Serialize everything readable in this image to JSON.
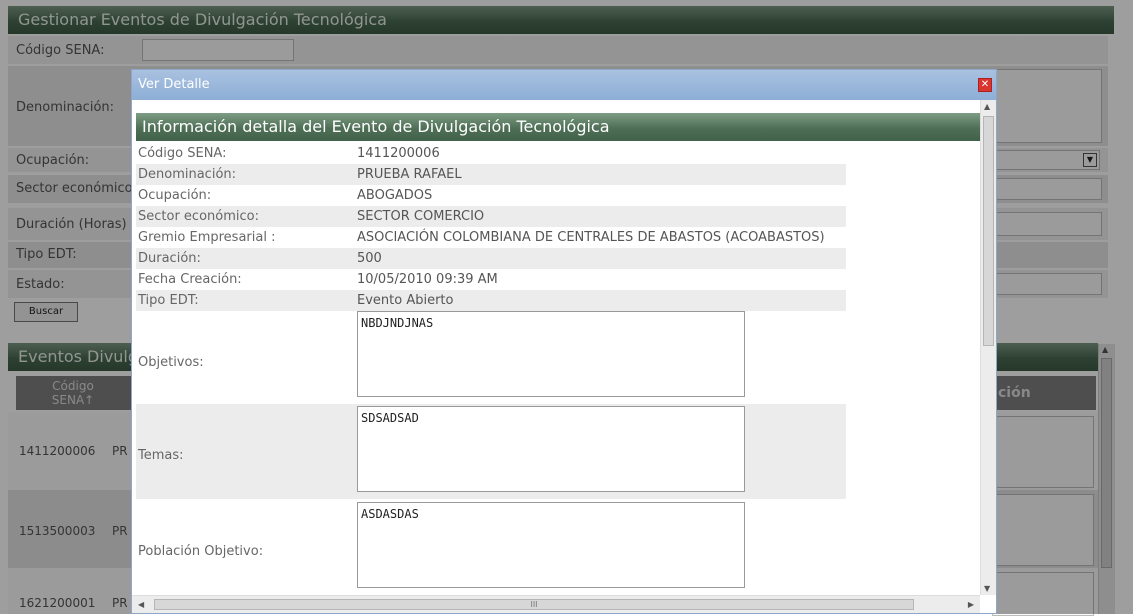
{
  "page": {
    "title": "Gestionar Eventos de Divulgación Tecnológica",
    "fields": {
      "codigo": "Código SENA:",
      "denominacion": "Denominación:",
      "ocupacion": "Ocupación:",
      "sector": "Sector económico",
      "duracion": "Duración (Horas)",
      "tipo": "Tipo EDT:",
      "estado": "Estado:"
    },
    "search_button": "Buscar",
    "results_title": "Eventos Divulg",
    "table": {
      "col_codigo": "Código SENA↑",
      "col_right": "ción"
    },
    "rows": [
      {
        "codigo": "1411200006",
        "denom": "PR"
      },
      {
        "codigo": "1513500003",
        "denom": "PR"
      },
      {
        "codigo": "1621200001",
        "denom": "PR"
      }
    ]
  },
  "modal": {
    "title": "Ver Detalle",
    "close": "✕",
    "header": "Información detalla del Evento de Divulgación Tecnológica",
    "details": [
      {
        "label": "Código SENA:",
        "value": "1411200006"
      },
      {
        "label": "Denominación:",
        "value": "PRUEBA RAFAEL"
      },
      {
        "label": "Ocupación:",
        "value": "ABOGADOS"
      },
      {
        "label": "Sector económico:",
        "value": "SECTOR COMERCIO"
      },
      {
        "label": "Gremio Empresarial :",
        "value": "ASOCIACIÓN COLOMBIANA DE CENTRALES DE ABASTOS (ACOABASTOS)"
      },
      {
        "label": "Duración:",
        "value": "500"
      },
      {
        "label": "Fecha Creación:",
        "value": "10/05/2010 09:39 AM"
      },
      {
        "label": "Tipo EDT:",
        "value": "Evento Abierto"
      }
    ],
    "textareas": [
      {
        "label": "Objetivos:",
        "value": "NBDJNDJNAS"
      },
      {
        "label": "Temas:",
        "value": "SDSADSAD"
      },
      {
        "label": "Población Objetivo:",
        "value": "ASDASDAS"
      }
    ],
    "hscroll_grip": "III"
  }
}
